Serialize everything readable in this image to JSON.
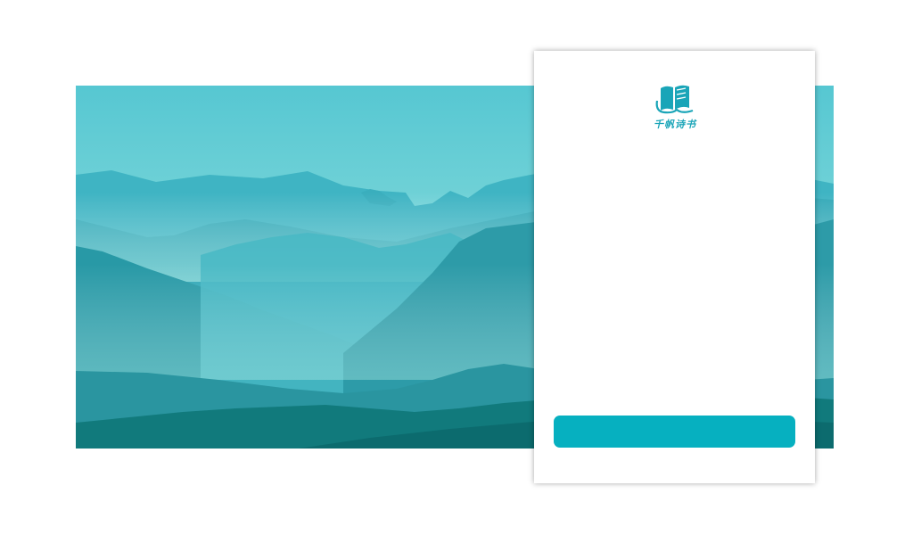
{
  "brand": {
    "logo_icon": "open-book-icon",
    "name": "千帆诗书",
    "color": "#1aa5b8"
  },
  "banner": {
    "image": "misty-teal-mountains",
    "sky_color": "#56c7d2",
    "foreground_color": "#0c6b6e"
  },
  "login": {
    "button_label": "",
    "button_color": "#06b0c0"
  }
}
